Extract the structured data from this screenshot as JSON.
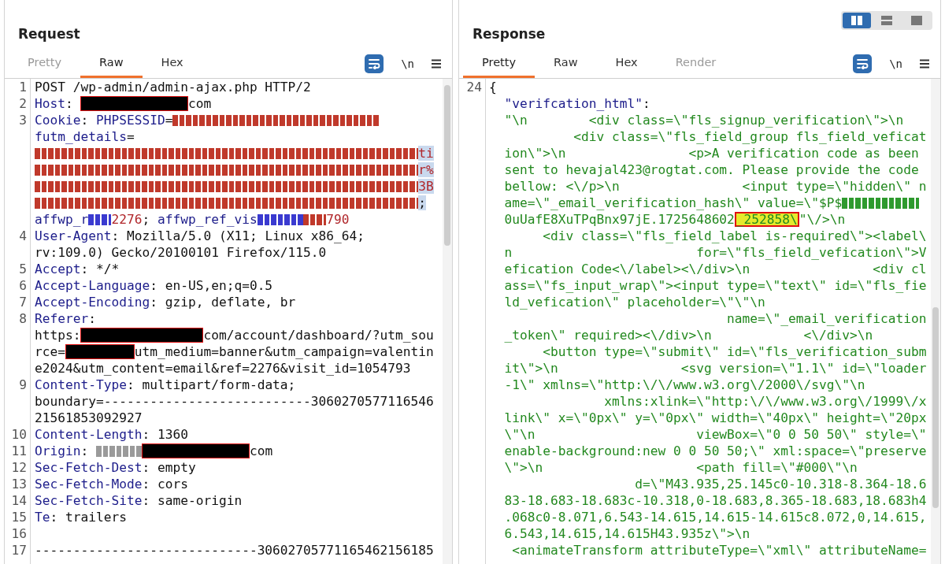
{
  "request": {
    "title": "Request",
    "tabs": [
      {
        "label": "Pretty",
        "selected": false,
        "disabled": true
      },
      {
        "label": "Raw",
        "selected": true,
        "disabled": false
      },
      {
        "label": "Hex",
        "selected": false,
        "disabled": false
      }
    ],
    "wrap_on": true,
    "newline_toggle": "\\n",
    "lines": [
      {
        "num": "1",
        "highlighted": false,
        "parts": [
          {
            "kind": "text",
            "t": "POST /wp-admin/admin-ajax.php HTTP/2"
          }
        ]
      },
      {
        "num": "2",
        "highlighted": false,
        "parts": [
          {
            "kind": "key",
            "t": "Host"
          },
          {
            "kind": "text",
            "t": ": "
          },
          {
            "kind": "redacted-long"
          },
          {
            "kind": "text",
            "t": "com"
          }
        ]
      },
      {
        "num": "3",
        "highlighted": false,
        "parts": [
          {
            "kind": "key",
            "t": "Cookie"
          },
          {
            "kind": "text",
            "t": ": "
          },
          {
            "kind": "key",
            "t": "PHPSESSID"
          },
          {
            "kind": "text",
            "t": "="
          },
          {
            "kind": "blur-mid",
            "color": "#c0392b"
          }
        ]
      },
      {
        "highlighted": false,
        "parts": [
          {
            "kind": "key",
            "t": "futm_details"
          },
          {
            "kind": "text",
            "t": "="
          }
        ]
      },
      {
        "highlighted": true,
        "parts": [
          {
            "kind": "blur-long",
            "color": "#c0392b"
          },
          {
            "kind": "val",
            "t": "ti"
          }
        ]
      },
      {
        "highlighted": true,
        "parts": [
          {
            "kind": "blur-long",
            "color": "#c0392b"
          },
          {
            "kind": "val",
            "t": "r%"
          }
        ]
      },
      {
        "highlighted": true,
        "parts": [
          {
            "kind": "blur-long",
            "color": "#c0392b"
          },
          {
            "kind": "val",
            "t": "3B"
          }
        ]
      },
      {
        "highlighted": true,
        "parts": [
          {
            "kind": "blur-long",
            "color": "#c0392b"
          },
          {
            "kind": "text",
            "t": ";"
          }
        ]
      },
      {
        "highlighted": false,
        "parts": [
          {
            "kind": "key",
            "t": "affwp_r"
          },
          {
            "kind": "blur-tiny",
            "color": "#3a3ad0"
          },
          {
            "kind": "val",
            "t": "2276"
          },
          {
            "kind": "text",
            "t": "; "
          },
          {
            "kind": "key",
            "t": "affwp_ref_vis"
          },
          {
            "kind": "blur-small",
            "color": "#3a3ad0"
          },
          {
            "kind": "blur-tiny",
            "color": "#c0392b"
          },
          {
            "kind": "val",
            "t": "790"
          }
        ]
      },
      {
        "num": "4",
        "highlighted": false,
        "parts": [
          {
            "kind": "key",
            "t": "User-Agent"
          },
          {
            "kind": "text",
            "t": ": Mozilla/5.0 (X11; Linux x86_64;"
          }
        ]
      },
      {
        "highlighted": false,
        "parts": [
          {
            "kind": "text",
            "t": "rv:109.0) Gecko/20100101 Firefox/115.0"
          }
        ]
      },
      {
        "num": "5",
        "highlighted": false,
        "parts": [
          {
            "kind": "key",
            "t": "Accept"
          },
          {
            "kind": "text",
            "t": ": */*"
          }
        ]
      },
      {
        "num": "6",
        "highlighted": false,
        "parts": [
          {
            "kind": "key",
            "t": "Accept-Language"
          },
          {
            "kind": "text",
            "t": ": en-US,en;q=0.5"
          }
        ]
      },
      {
        "num": "7",
        "highlighted": false,
        "parts": [
          {
            "kind": "key",
            "t": "Accept-Encoding"
          },
          {
            "kind": "text",
            "t": ": gzip, deflate, br"
          }
        ]
      },
      {
        "num": "8",
        "highlighted": false,
        "parts": [
          {
            "kind": "key",
            "t": "Referer"
          },
          {
            "kind": "text",
            "t": ":"
          }
        ]
      },
      {
        "highlighted": false,
        "parts": [
          {
            "kind": "text",
            "t": "https:"
          },
          {
            "kind": "redacted-xl"
          },
          {
            "kind": "text",
            "t": "com/account/dashboard/?utm_sou"
          }
        ]
      },
      {
        "highlighted": false,
        "parts": [
          {
            "kind": "text",
            "t": "rce="
          },
          {
            "kind": "redacted-short"
          },
          {
            "kind": "text",
            "t": "utm_medium=banner&utm_campaign=valentin"
          }
        ]
      },
      {
        "highlighted": false,
        "parts": [
          {
            "kind": "text",
            "t": "e2024&utm_content=email&ref=2276&visit_id=1054793"
          }
        ]
      },
      {
        "num": "9",
        "highlighted": false,
        "parts": [
          {
            "kind": "key",
            "t": "Content-Type"
          },
          {
            "kind": "text",
            "t": ": multipart/form-data;"
          }
        ]
      },
      {
        "highlighted": false,
        "parts": [
          {
            "kind": "text",
            "t": "boundary=---------------------------3060270577116546"
          }
        ]
      },
      {
        "highlighted": false,
        "parts": [
          {
            "kind": "text",
            "t": "21561853092927"
          }
        ]
      },
      {
        "num": "10",
        "highlighted": false,
        "parts": [
          {
            "kind": "key",
            "t": "Content-Length"
          },
          {
            "kind": "text",
            "t": ": 1360"
          }
        ]
      },
      {
        "num": "11",
        "highlighted": false,
        "parts": [
          {
            "kind": "key",
            "t": "Origin"
          },
          {
            "kind": "text",
            "t": ": "
          },
          {
            "kind": "blur-small",
            "color": "#9a9a9a"
          },
          {
            "kind": "redacted-long"
          },
          {
            "kind": "text",
            "t": "com"
          }
        ]
      },
      {
        "num": "12",
        "highlighted": false,
        "parts": [
          {
            "kind": "key",
            "t": "Sec-Fetch-Dest"
          },
          {
            "kind": "text",
            "t": ": empty"
          }
        ]
      },
      {
        "num": "13",
        "highlighted": false,
        "parts": [
          {
            "kind": "key",
            "t": "Sec-Fetch-Mode"
          },
          {
            "kind": "text",
            "t": ": cors"
          }
        ]
      },
      {
        "num": "14",
        "highlighted": false,
        "parts": [
          {
            "kind": "key",
            "t": "Sec-Fetch-Site"
          },
          {
            "kind": "text",
            "t": ": same-origin"
          }
        ]
      },
      {
        "num": "15",
        "highlighted": false,
        "parts": [
          {
            "kind": "key",
            "t": "Te"
          },
          {
            "kind": "text",
            "t": ": trailers"
          }
        ]
      },
      {
        "num": "16"
      },
      {
        "num": "17",
        "highlighted": false,
        "parts": [
          {
            "kind": "text",
            "t": "-----------------------------30602705771165462156185"
          }
        ]
      }
    ]
  },
  "response": {
    "title": "Response",
    "tabs": [
      {
        "label": "Pretty",
        "selected": true,
        "disabled": false
      },
      {
        "label": "Raw",
        "selected": false,
        "disabled": false
      },
      {
        "label": "Hex",
        "selected": false,
        "disabled": false
      },
      {
        "label": "Render",
        "selected": false,
        "disabled": true
      }
    ],
    "wrap_on": true,
    "newline_toggle": "\\n",
    "layout_buttons": [
      {
        "kind": "columns",
        "selected": true
      },
      {
        "kind": "rows",
        "selected": false
      },
      {
        "kind": "single",
        "selected": false
      }
    ],
    "lines": [
      {
        "num": "24",
        "parts": [
          {
            "kind": "text",
            "t": "{"
          }
        ]
      },
      {
        "parts": [
          {
            "kind": "key",
            "t": "  \"verifcation_html\""
          },
          {
            "kind": "text",
            "t": ":"
          }
        ]
      },
      {
        "parts": [
          {
            "kind": "str",
            "t": "  \"\\n        <div class=\\\"fls_signup_verification\\\">\\n"
          }
        ]
      },
      {
        "parts": [
          {
            "kind": "str",
            "t": "           <div class=\\\"fls_field_group fls_field_veficat"
          }
        ]
      },
      {
        "parts": [
          {
            "kind": "str",
            "t": "  ion\\\">\\n                <p>A verification code as been"
          }
        ]
      },
      {
        "parts": [
          {
            "kind": "str",
            "t": "  sent to hevajal423@rogtat.com. Please provide the code"
          }
        ]
      },
      {
        "parts": [
          {
            "kind": "str",
            "t": "  bellow: <\\/p>\\n                <input type=\\\"hidden\\\" n"
          }
        ]
      },
      {
        "parts": [
          {
            "kind": "str",
            "t": "  ame=\\\"_email_verification_hash\\\" value=\\\"$P$"
          },
          {
            "kind": "blur-medium",
            "color": "#2e9a2e"
          }
        ]
      },
      {
        "parts": [
          {
            "kind": "str",
            "t": "  0uUafE8XuTPqBnx97jE.1725648602"
          },
          {
            "kind": "marked",
            "t": "_252858\\"
          },
          {
            "kind": "str",
            "t": "\"\\/>\\n"
          }
        ]
      },
      {
        "parts": [
          {
            "kind": "str",
            "t": "       <div class=\\\"fls_field_label is-required\\\"><label\\"
          }
        ]
      },
      {
        "parts": [
          {
            "kind": "str",
            "t": "  n                        for=\\\"fls_field_vefication\\\">V"
          }
        ]
      },
      {
        "parts": [
          {
            "kind": "str",
            "t": "  efication Code<\\/label><\\/div>\\n                <div cl"
          }
        ]
      },
      {
        "parts": [
          {
            "kind": "str",
            "t": "  ass=\\\"fs_input_wrap\\\"><input type=\\\"text\\\" id=\\\"fls_fie"
          }
        ]
      },
      {
        "parts": [
          {
            "kind": "str",
            "t": "  ld_vefication\\\" placeholder=\\\"\\\"\\n"
          }
        ]
      },
      {
        "parts": [
          {
            "kind": "str",
            "t": "                               name=\\\"_email_verification"
          }
        ]
      },
      {
        "parts": [
          {
            "kind": "str",
            "t": "  _token\\\" required><\\/div>\\n            <\\/div>\\n"
          }
        ]
      },
      {
        "parts": [
          {
            "kind": "str",
            "t": "       <button type=\\\"submit\\\" id=\\\"fls_verification_subm"
          }
        ]
      },
      {
        "parts": [
          {
            "kind": "str",
            "t": "  it\\\">\\n                <svg version=\\\"1.1\\\" id=\\\"loader"
          }
        ]
      },
      {
        "parts": [
          {
            "kind": "str",
            "t": "  -1\\\" xmlns=\\\"http:\\/\\/www.w3.org\\/2000\\/svg\\\"\\n"
          }
        ]
      },
      {
        "parts": [
          {
            "kind": "str",
            "t": "               xmlns:xlink=\\\"http:\\/\\/www.w3.org\\/1999\\/x"
          }
        ]
      },
      {
        "parts": [
          {
            "kind": "str",
            "t": "  link\\\" x=\\\"0px\\\" y=\\\"0px\\\" width=\\\"40px\\\" height=\\\"20px"
          }
        ]
      },
      {
        "parts": [
          {
            "kind": "str",
            "t": "  \\\"\\n                     viewBox=\\\"0 0 50 50\\\" style=\\\""
          }
        ]
      },
      {
        "parts": [
          {
            "kind": "str",
            "t": "  enable-background:new 0 0 50 50;\\\" xml:space=\\\"preserve"
          }
        ]
      },
      {
        "parts": [
          {
            "kind": "str",
            "t": "  \\\">\\n                    <path fill=\\\"#000\\\"\\n"
          }
        ]
      },
      {
        "parts": [
          {
            "kind": "str",
            "t": "                   d=\\\"M43.935,25.145c0-10.318-8.364-18.6"
          }
        ]
      },
      {
        "parts": [
          {
            "kind": "str",
            "t": "  83-18.683-18.683c-10.318,0-18.683,8.365-18.683,18.683h4"
          }
        ]
      },
      {
        "parts": [
          {
            "kind": "str",
            "t": "  .068c0-8.071,6.543-14.615,14.615-14.615c8.072,0,14.615,"
          }
        ]
      },
      {
        "parts": [
          {
            "kind": "str",
            "t": "  6.543,14.615,14.615H43.935z\\\">\\n"
          }
        ]
      },
      {
        "parts": [
          {
            "kind": "str",
            "t": "   <animateTransform attributeType=\\\"xml\\\" attributeName="
          }
        ]
      }
    ]
  }
}
